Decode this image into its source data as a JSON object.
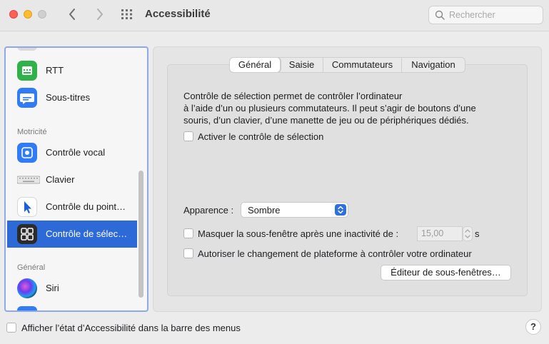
{
  "window": {
    "title": "Accessibilité",
    "search_placeholder": "Rechercher"
  },
  "sidebar": {
    "items": [
      {
        "label": "RTT",
        "icon": "tty-icon"
      },
      {
        "label": "Sous-titres",
        "icon": "subtitles-icon"
      },
      {
        "label": "Contrôle vocal",
        "icon": "voice-control-icon"
      },
      {
        "label": "Clavier",
        "icon": "keyboard-icon"
      },
      {
        "label": "Contrôle du point…",
        "icon": "pointer-icon"
      },
      {
        "label": "Contrôle de sélec…",
        "icon": "switch-control-icon",
        "selected": true
      },
      {
        "label": "Siri",
        "icon": "siri-icon"
      }
    ],
    "headers": {
      "motricite": "Motricité",
      "general": "Général"
    }
  },
  "tabs": [
    {
      "label": "Général",
      "active": true
    },
    {
      "label": "Saisie"
    },
    {
      "label": "Commutateurs"
    },
    {
      "label": "Navigation"
    }
  ],
  "main": {
    "description_lines": [
      "Contrôle de sélection permet de contrôler l’ordinateur",
      "à l’aide d’un ou plusieurs commutateurs. Il peut s’agir de boutons d’une",
      "souris, d’un clavier, d’une manette de jeu ou de périphériques dédiés."
    ],
    "enable_label": "Activer le contrôle de sélection",
    "appearance_label": "Apparence :",
    "appearance_value": "Sombre",
    "hide_panel_label": "Masquer la sous-fenêtre après une inactivité de :",
    "hide_panel_value": "15,00",
    "hide_panel_unit": "s",
    "platform_label": "Autoriser le changement de plateforme à contrôler votre ordinateur",
    "editor_button": "Éditeur de sous-fenêtres…"
  },
  "footer": {
    "menu_bar_label": "Afficher l’état d’Accessibilité dans la barre des menus",
    "help_label": "?"
  },
  "colors": {
    "selection_blue": "#2e6ad7",
    "sidebar_focus_ring": "#8fa9e8"
  }
}
